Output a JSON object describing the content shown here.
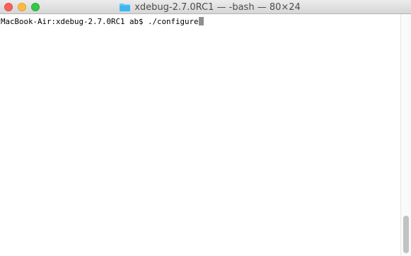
{
  "window": {
    "title": "xdebug-2.7.0RC1 — -bash — 80×24"
  },
  "icons": {
    "title_icon": "folder-icon"
  },
  "colors": {
    "close": "#fc605c",
    "minimize": "#fdbc40",
    "zoom": "#34c84a",
    "folder": "#5ac8fa"
  },
  "terminal": {
    "prompt": "MacBook-Air:xdebug-2.7.0RC1 ab$ ",
    "command": "./configure"
  }
}
